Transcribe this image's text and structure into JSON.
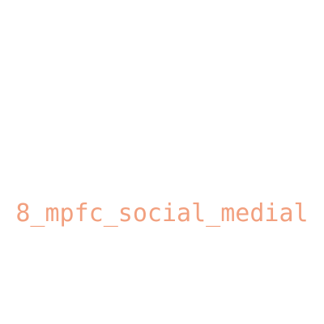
{
  "label": {
    "text": "8_mpfc_social_medial",
    "color": "#f2a07f"
  },
  "background_color": "#ffffff"
}
